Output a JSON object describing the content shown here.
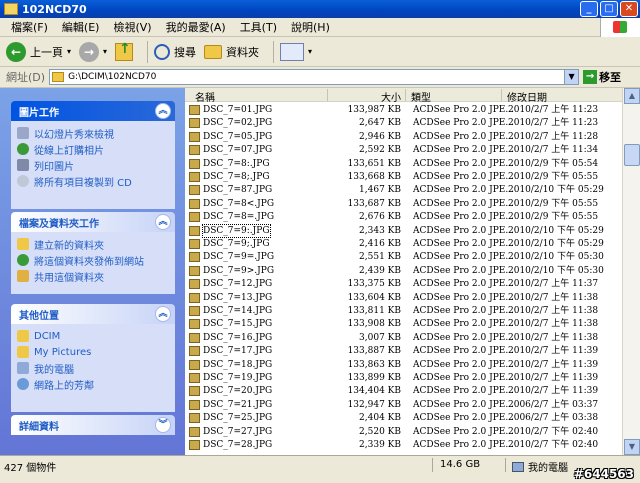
{
  "window": {
    "title": "102NCD70"
  },
  "menu": [
    "檔案(F)",
    "編輯(E)",
    "檢視(V)",
    "我的最愛(A)",
    "工具(T)",
    "說明(H)"
  ],
  "toolbar": {
    "back": "上一頁",
    "search": "搜尋",
    "folders": "資料夾"
  },
  "address": {
    "label": "網址(D)",
    "path": "G:\\DCIM\\102NCD70",
    "go": "移至"
  },
  "tasks": {
    "picture": {
      "title": "圖片工作",
      "items": [
        "以幻燈片秀來檢視",
        "從線上訂購相片",
        "列印圖片",
        "將所有項目複製到 CD"
      ]
    },
    "file": {
      "title": "檔案及資料夾工作",
      "items": [
        "建立新的資料夾",
        "將這個資料夾發佈到網站",
        "共用這個資料夾"
      ]
    },
    "other": {
      "title": "其他位置",
      "items": [
        "DCIM",
        "My Pictures",
        "我的電腦",
        "網路上的芳鄰"
      ]
    },
    "details": {
      "title": "詳細資料"
    }
  },
  "columns": {
    "name": "名稱",
    "size": "大小",
    "type": "類型",
    "date": "修改日期"
  },
  "files": [
    {
      "name": "DSC_7=01.JPG",
      "size": "133,987 KB",
      "type": "ACDSee Pro 2.0 JPE...",
      "date": "2010/2/7 上午 11:23"
    },
    {
      "name": "DSC_7=02.JPG",
      "size": "2,647 KB",
      "type": "ACDSee Pro 2.0 JPE...",
      "date": "2010/2/7 上午 11:23"
    },
    {
      "name": "DSC_7=05.JPG",
      "size": "2,946 KB",
      "type": "ACDSee Pro 2.0 JPE...",
      "date": "2010/2/7 上午 11:28"
    },
    {
      "name": "DSC_7=07.JPG",
      "size": "2,592 KB",
      "type": "ACDSee Pro 2.0 JPE...",
      "date": "2010/2/7 上午 11:34"
    },
    {
      "name": "DSC_7=8:.JPG",
      "size": "133,651 KB",
      "type": "ACDSee Pro 2.0 JPE...",
      "date": "2010/2/9 下午 05:54"
    },
    {
      "name": "DSC_7=8;.JPG",
      "size": "133,668 KB",
      "type": "ACDSee Pro 2.0 JPE...",
      "date": "2010/2/9 下午 05:55"
    },
    {
      "name": "DSC_7=87.JPG",
      "size": "1,467 KB",
      "type": "ACDSee Pro 2.0 JPE...",
      "date": "2010/2/10 下午 05:29"
    },
    {
      "name": "DSC_7=8<.JPG",
      "size": "133,687 KB",
      "type": "ACDSee Pro 2.0 JPE...",
      "date": "2010/2/9 下午 05:55"
    },
    {
      "name": "DSC_7=8=.JPG",
      "size": "2,676 KB",
      "type": "ACDSee Pro 2.0 JPE...",
      "date": "2010/2/9 下午 05:55"
    },
    {
      "name": "DSC_7=9:.JPG",
      "size": "2,343 KB",
      "type": "ACDSee Pro 2.0 JPE...",
      "date": "2010/2/10 下午 05:29"
    },
    {
      "name": "DSC_7=9;.JPG",
      "size": "2,416 KB",
      "type": "ACDSee Pro 2.0 JPE...",
      "date": "2010/2/10 下午 05:29"
    },
    {
      "name": "DSC_7=9=.JPG",
      "size": "2,551 KB",
      "type": "ACDSee Pro 2.0 JPE...",
      "date": "2010/2/10 下午 05:30"
    },
    {
      "name": "DSC_7=9>.JPG",
      "size": "2,439 KB",
      "type": "ACDSee Pro 2.0 JPE...",
      "date": "2010/2/10 下午 05:30"
    },
    {
      "name": "DSC_7=12.JPG",
      "size": "133,375 KB",
      "type": "ACDSee Pro 2.0 JPE...",
      "date": "2010/2/7 上午 11:37"
    },
    {
      "name": "DSC_7=13.JPG",
      "size": "133,604 KB",
      "type": "ACDSee Pro 2.0 JPE...",
      "date": "2010/2/7 上午 11:38"
    },
    {
      "name": "DSC_7=14.JPG",
      "size": "133,811 KB",
      "type": "ACDSee Pro 2.0 JPE...",
      "date": "2010/2/7 上午 11:38"
    },
    {
      "name": "DSC_7=15.JPG",
      "size": "133,908 KB",
      "type": "ACDSee Pro 2.0 JPE...",
      "date": "2010/2/7 上午 11:38"
    },
    {
      "name": "DSC_7=16.JPG",
      "size": "3,007 KB",
      "type": "ACDSee Pro 2.0 JPE...",
      "date": "2010/2/7 上午 11:38"
    },
    {
      "name": "DSC_7=17.JPG",
      "size": "133,887 KB",
      "type": "ACDSee Pro 2.0 JPE...",
      "date": "2010/2/7 上午 11:39"
    },
    {
      "name": "DSC_7=18.JPG",
      "size": "133,863 KB",
      "type": "ACDSee Pro 2.0 JPE...",
      "date": "2010/2/7 上午 11:39"
    },
    {
      "name": "DSC_7=19.JPG",
      "size": "133,899 KB",
      "type": "ACDSee Pro 2.0 JPE...",
      "date": "2010/2/7 上午 11:39"
    },
    {
      "name": "DSC_7=20.JPG",
      "size": "134,404 KB",
      "type": "ACDSee Pro 2.0 JPE...",
      "date": "2010/2/7 上午 11:39"
    },
    {
      "name": "DSC_7=21.JPG",
      "size": "132,947 KB",
      "type": "ACDSee Pro 2.0 JPE...",
      "date": "2006/2/7 上午 03:37"
    },
    {
      "name": "DSC_7=25.JPG",
      "size": "2,404 KB",
      "type": "ACDSee Pro 2.0 JPE...",
      "date": "2006/2/7 上午 03:38"
    },
    {
      "name": "DSC_7=27.JPG",
      "size": "2,520 KB",
      "type": "ACDSee Pro 2.0 JPE...",
      "date": "2010/2/7 下午 02:40"
    },
    {
      "name": "DSC_7=28.JPG",
      "size": "2,339 KB",
      "type": "ACDSee Pro 2.0 JPE...",
      "date": "2010/2/7 下午 02:40"
    }
  ],
  "selected_index": 9,
  "status": {
    "count": "427 個物件",
    "size": "14.6 GB",
    "location": "我的電腦"
  },
  "watermark": "#644563",
  "colors": {
    "title_bar": "#0044c0",
    "task_pane": "#6375d6",
    "panel_header_text": "#215dc6"
  }
}
